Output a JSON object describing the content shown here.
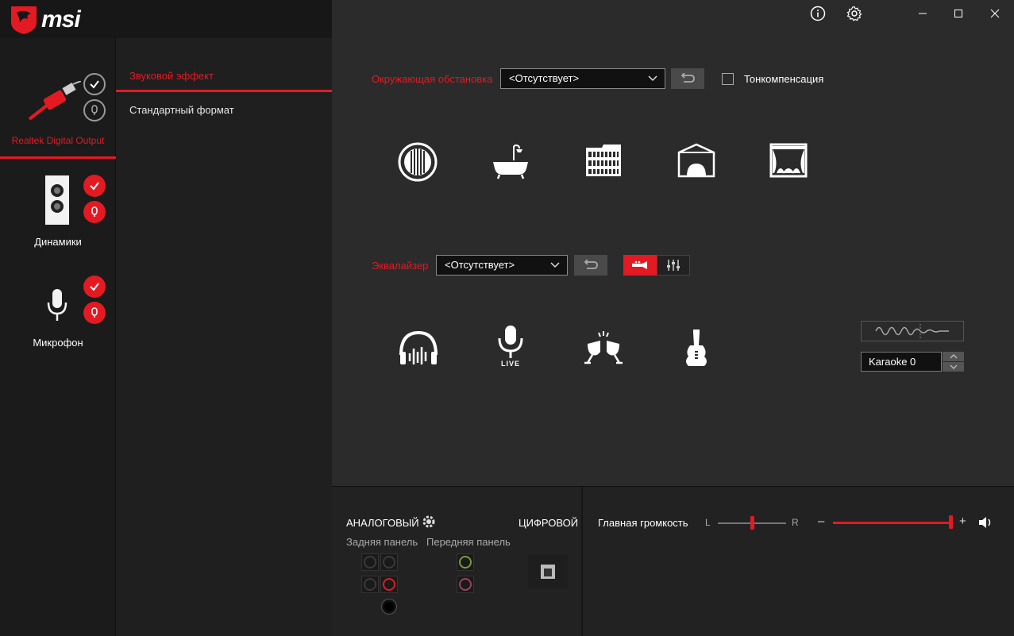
{
  "app": {
    "brand": "msi"
  },
  "devices": [
    {
      "label": "Realtek Digital Output",
      "selected": true
    },
    {
      "label": "Динамики",
      "selected": false
    },
    {
      "label": "Микрофон",
      "selected": false
    }
  ],
  "menu": {
    "items": [
      {
        "label": "Звуковой эффект",
        "active": true
      },
      {
        "label": "Стандартный формат",
        "active": false
      }
    ]
  },
  "environment": {
    "label": "Окружающая обстановка",
    "select_value": "<Отсутствует>",
    "loudness_label": "Тонкомпенсация",
    "loudness_checked": false,
    "presets": [
      "generic-room-icon",
      "bathroom-icon",
      "colosseum-icon",
      "stage-icon",
      "theater-icon"
    ]
  },
  "equalizer": {
    "label": "Эквалайзер",
    "select_value": "<Отсутствует>",
    "presets": [
      "headphones-icon",
      "live-mic-icon",
      "party-icon",
      "guitar-icon"
    ],
    "live_text": "LIVE",
    "karaoke_value": "Karaoke 0"
  },
  "bottom": {
    "analog_label": "АНАЛОГОВЫЙ",
    "digital_label": "ЦИФРОВОЙ",
    "rear_panel": "Задняя панель",
    "front_panel": "Передняя панель",
    "main_volume_label": "Главная громкость",
    "balance_left": "L",
    "balance_right": "R",
    "vol_minus": "–",
    "vol_plus": "+",
    "balance_value": 0.5,
    "volume_value": 1.0
  },
  "colors": {
    "accent": "#e31a22",
    "background": "#2b2b2b",
    "sidebar": "#1b1b1b"
  }
}
